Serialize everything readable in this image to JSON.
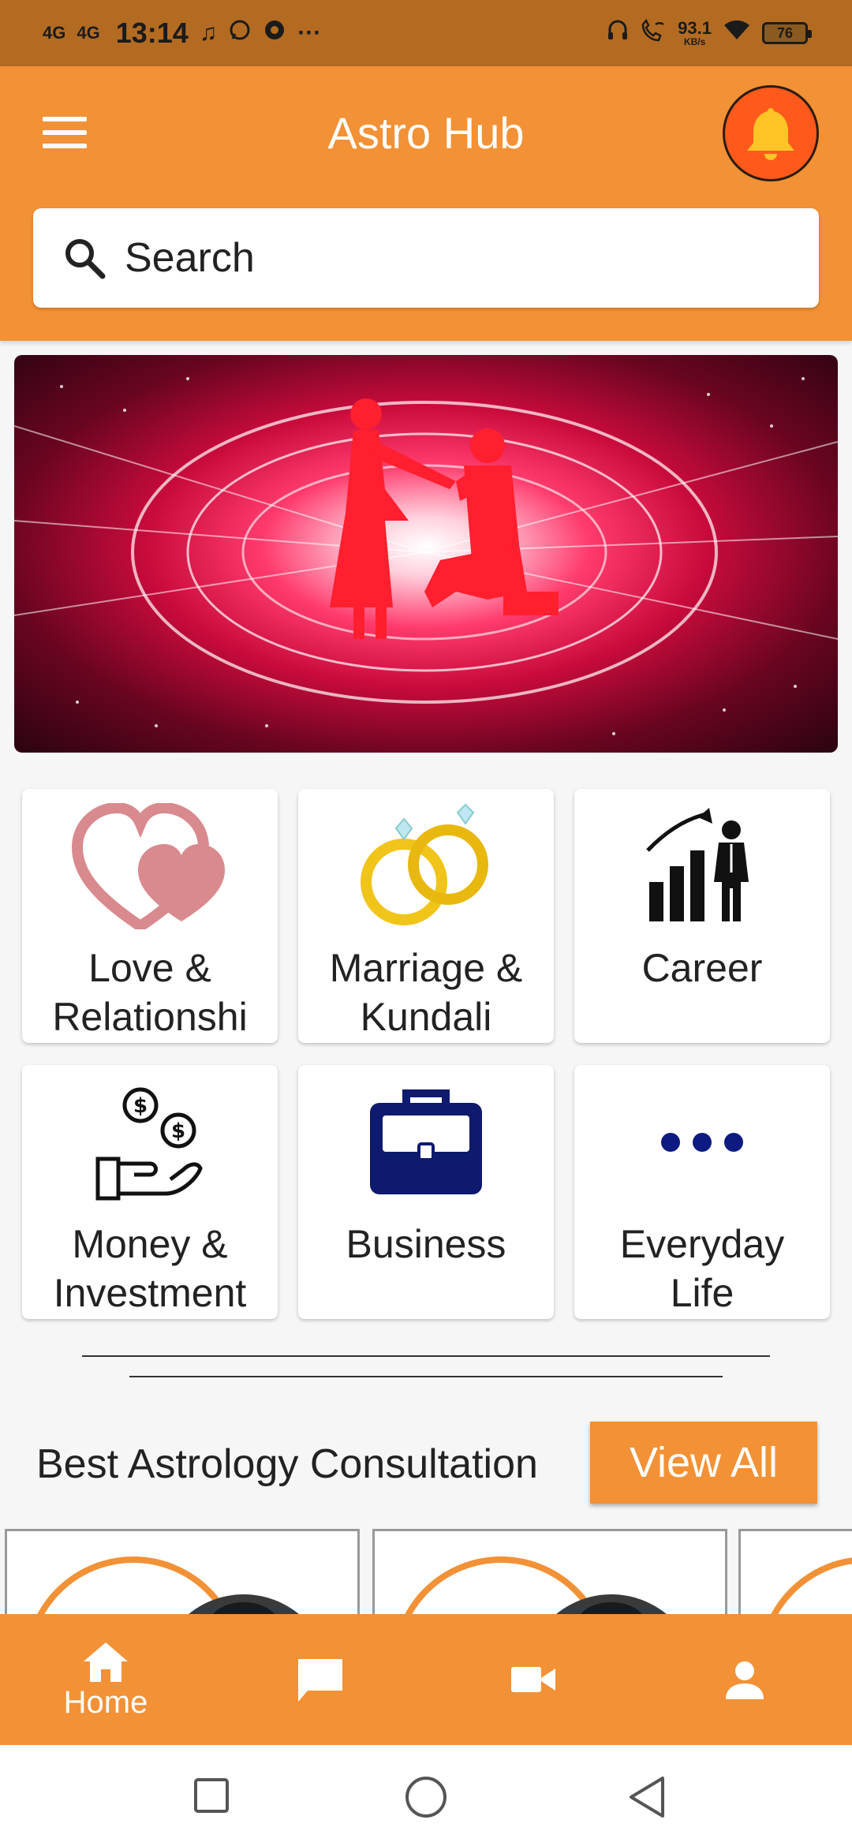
{
  "status_bar": {
    "signal1": "4G",
    "signal2": "4G",
    "time": "13:14",
    "speed_value": "93.1",
    "speed_unit": "KB/s",
    "battery": "76"
  },
  "header": {
    "title": "Astro Hub",
    "search_placeholder": "Search"
  },
  "categories": [
    {
      "label": "Love &\nRelationshi",
      "icon": "hearts-icon"
    },
    {
      "label": "Marriage &\nKundali",
      "icon": "rings-icon"
    },
    {
      "label": "Career",
      "icon": "career-growth-icon"
    },
    {
      "label": "Money &\nInvestment",
      "icon": "money-hand-icon"
    },
    {
      "label": "Business",
      "icon": "briefcase-icon"
    },
    {
      "label": "Everyday\nLife",
      "icon": "more-dots-icon"
    }
  ],
  "consultation": {
    "title": "Best Astrology Consultation",
    "view_all": "View All"
  },
  "bottom_nav": {
    "home": "Home"
  },
  "colors": {
    "accent": "#f29135",
    "status_bar": "#b36b22",
    "bell": "#ff5a1c",
    "briefcase": "#0d1a6e"
  }
}
